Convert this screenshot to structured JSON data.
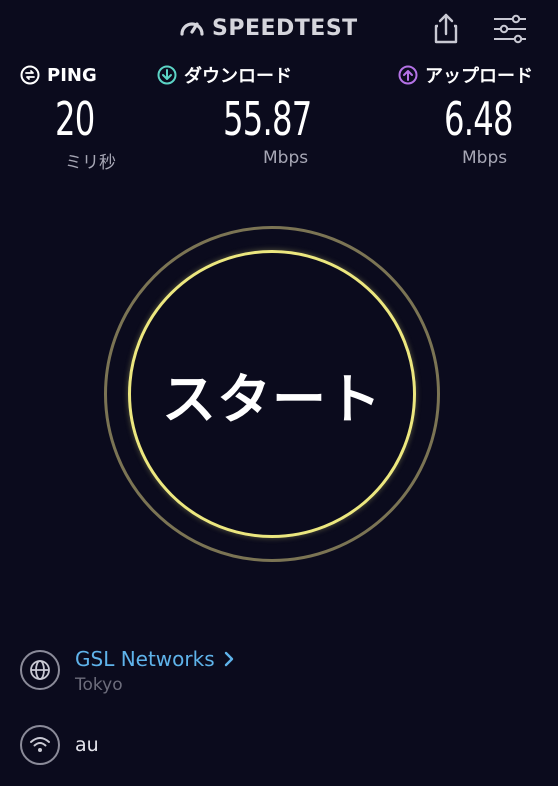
{
  "header": {
    "logo_text": "SPEEDTEST",
    "share_icon": "share-icon",
    "settings_icon": "sliders-icon"
  },
  "metrics": {
    "ping": {
      "title": "PING",
      "value": "20",
      "unit": "ミリ秒",
      "icon": "ping-icon",
      "color": "#ffffff"
    },
    "download": {
      "title": "ダウンロード",
      "value": "55.87",
      "unit": "Mbps",
      "icon": "download-arrow-icon",
      "color": "#5cd4c6"
    },
    "upload": {
      "title": "アップロード",
      "value": "6.48",
      "unit": "Mbps",
      "icon": "upload-arrow-icon",
      "color": "#b472e6"
    }
  },
  "start": {
    "label": "スタート"
  },
  "server": {
    "name": "GSL Networks",
    "location": "Tokyo",
    "icon": "globe-icon",
    "accent": "#5fb3ea"
  },
  "connection": {
    "isp": "au",
    "icon": "wifi-icon"
  }
}
